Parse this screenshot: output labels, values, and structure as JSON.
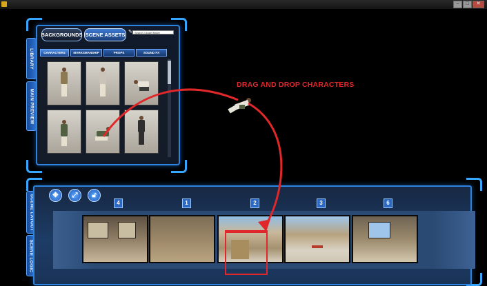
{
  "library": {
    "tabs": [
      "BACKGROUNDS",
      "SCENE ASSETS"
    ],
    "search_placeholder": "Search / Asset finder",
    "side_tabs": [
      "LIBRARY",
      "MAIN PREVIEW"
    ],
    "categories": [
      "CHARACTERS",
      "MARKSMANSHIP",
      "PROPS",
      "SOUND FX"
    ]
  },
  "instruction": "DRAG AND DROP CHARACTERS",
  "timeline": {
    "side_tabs": [
      "SCENE LAYOUT",
      "SCENE LOGIC"
    ],
    "tools": [
      "move-icon",
      "resize-icon",
      "lock-icon"
    ],
    "frame_numbers": [
      "4",
      "1",
      "2",
      "3",
      "6"
    ]
  },
  "window": {
    "controls": [
      "–",
      "□",
      "✕"
    ]
  },
  "colors": {
    "accent": "#2c84e0",
    "highlight": "#e0282a"
  }
}
